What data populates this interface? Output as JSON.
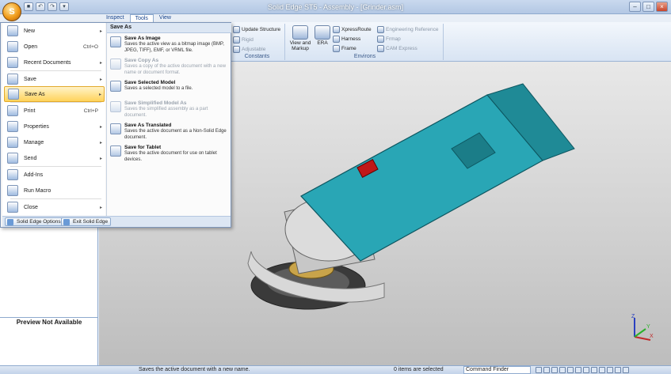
{
  "window": {
    "title": "Solid Edge ST5 - Assembly - [Grinder.asm]"
  },
  "app_button": {
    "glyph": "S"
  },
  "quick_access": [
    "■",
    "↶",
    "↷",
    "▾"
  ],
  "window_controls": [
    "–",
    "□",
    "×"
  ],
  "ribbon_tabs": [
    "Inspect",
    "Tools",
    "View"
  ],
  "ribbon": {
    "g1_items": [
      "Update Structure",
      "Rigid",
      "Adjustable"
    ],
    "g1_label": "Constants",
    "view_markup": "View and Markup",
    "era": "ERA",
    "envs": [
      "XpressRoute",
      "Harness",
      "Frame"
    ],
    "env_dim": [
      "Engineering Reference",
      "Frmap",
      "CAM Express"
    ],
    "env_label": "Environs"
  },
  "app_menu": {
    "items": [
      {
        "label": "New",
        "shortcut": "",
        "arrow": "▸"
      },
      {
        "label": "Open",
        "shortcut": "Ctrl+O",
        "arrow": ""
      },
      {
        "label": "Recent Documents",
        "shortcut": "",
        "arrow": "▸"
      },
      {
        "label": "Save",
        "shortcut": "",
        "arrow": "▸"
      },
      {
        "label": "Save As",
        "shortcut": "",
        "arrow": "▸"
      },
      {
        "label": "Print",
        "shortcut": "Ctrl+P",
        "arrow": ""
      },
      {
        "label": "Properties",
        "shortcut": "",
        "arrow": "▸"
      },
      {
        "label": "Manage",
        "shortcut": "",
        "arrow": "▸"
      },
      {
        "label": "Send",
        "shortcut": "",
        "arrow": "▸"
      },
      {
        "label": "Add-Ins",
        "shortcut": "",
        "arrow": ""
      },
      {
        "label": "Run Macro",
        "shortcut": "",
        "arrow": ""
      },
      {
        "label": "Close",
        "shortcut": "",
        "arrow": "▸"
      }
    ],
    "submenu_title": "Save As",
    "submenu": [
      {
        "title": "Save As Image",
        "desc": "Saves the active view as a bitmap image (BMP, JPEG, TIFF), EMF, or VRML file."
      },
      {
        "title": "Save Copy As",
        "desc": "Saves a copy of the active document with a new name or document format."
      },
      {
        "title": "Save Selected Model",
        "desc": "Saves a selected model to a file."
      },
      {
        "title": "Save Simplified Model As",
        "desc": "Saves the simplified assembly as a part document."
      },
      {
        "title": "Save As Translated",
        "desc": "Saves the active document as a Non-Solid Edge document."
      },
      {
        "title": "Save for Tablet",
        "desc": "Saves the active document for use on tablet devices."
      }
    ],
    "options_button": "Solid Edge Options",
    "exit_button": "Exit Solid Edge"
  },
  "left_panel": {
    "preview": "Preview Not Available"
  },
  "status": {
    "prompt": "Saves the active document with a new name.",
    "count": "0 items are selected",
    "command_finder": "Command Finder"
  },
  "triad": {
    "z": "Z",
    "x": "X",
    "y": "Y"
  }
}
